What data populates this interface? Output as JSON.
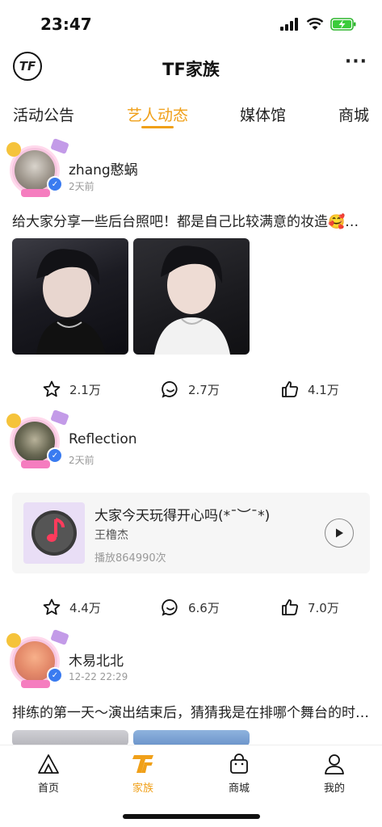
{
  "status_bar": {
    "time": "23:47"
  },
  "header": {
    "logo_text": "TF",
    "title": "TF家族",
    "more_label": "···"
  },
  "tabs": [
    {
      "label": "活动公告"
    },
    {
      "label": "艺人动态"
    },
    {
      "label": "媒体馆"
    },
    {
      "label": "商城"
    }
  ],
  "active_tab": "艺人动态",
  "posts": [
    {
      "username": "zhang憨蜗",
      "time": "2天前",
      "content": "给大家分享一些后台照吧！都是自己比较满意的妆造🥰…",
      "favorites": "2.1万",
      "comments": "2.7万",
      "likes": "4.1万"
    },
    {
      "username": "Reflection",
      "time": "2天前",
      "music": {
        "title": "大家今天玩得开心吗(*¯︶¯*)",
        "artist": "王橹杰",
        "plays": "播放864990次"
      },
      "favorites": "4.4万",
      "comments": "6.6万",
      "likes": "7.0万"
    },
    {
      "username": "木易北北",
      "time": "12-22 22:29",
      "content": "排练的第一天～演出结束后，猜猜我是在排哪个舞台的时…"
    }
  ],
  "bottom_nav": [
    {
      "label": "首页",
      "icon": "home-mountain-icon"
    },
    {
      "label": "家族",
      "icon": "tf-logo-icon"
    },
    {
      "label": "商城",
      "icon": "shopping-bag-icon"
    },
    {
      "label": "我的",
      "icon": "person-icon"
    }
  ],
  "colors": {
    "accent": "#f0a019",
    "verified": "#3a7bf0"
  }
}
